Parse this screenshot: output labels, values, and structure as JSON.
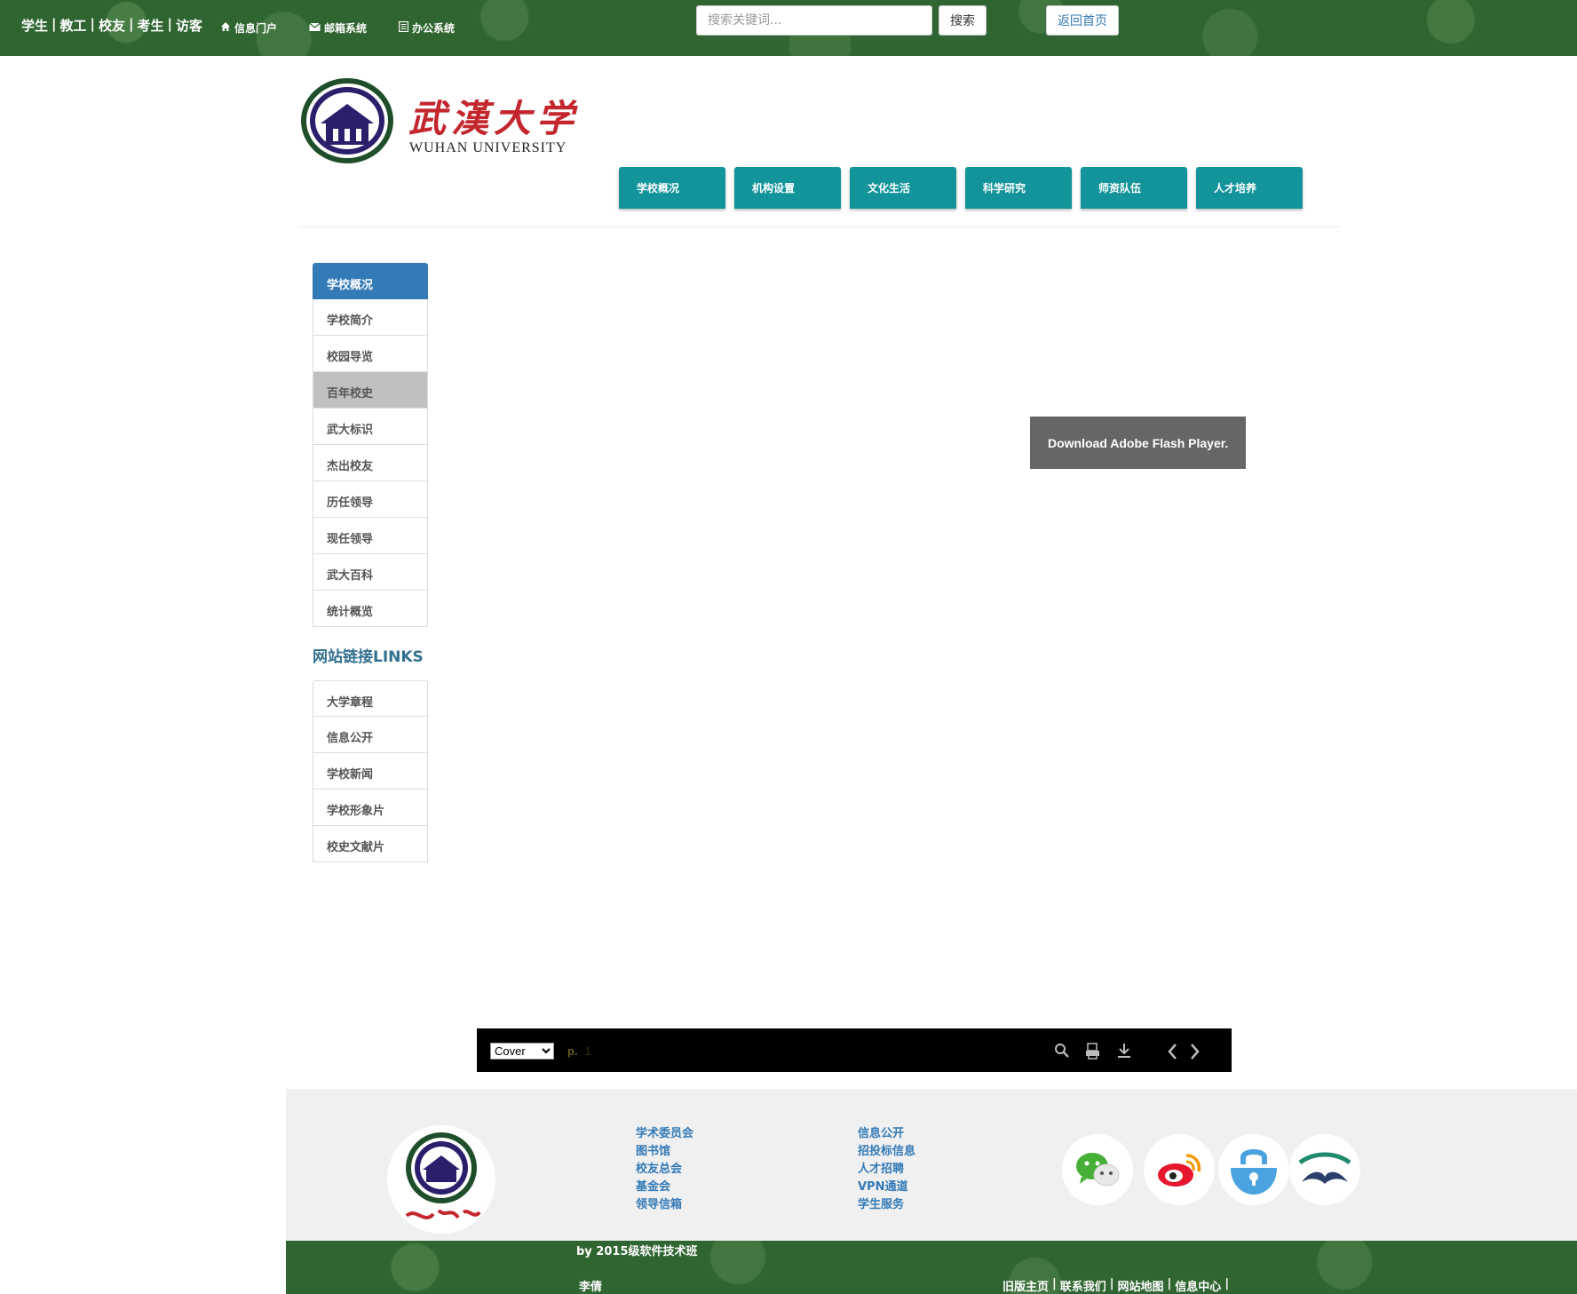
{
  "topbar": {
    "roles": [
      "学生",
      "教工",
      "校友",
      "考生",
      "访客"
    ],
    "separator": "|",
    "quick_links": [
      {
        "icon": "home-icon",
        "label": "信息门户"
      },
      {
        "icon": "mail-icon",
        "label": "邮箱系统"
      },
      {
        "icon": "document-icon",
        "label": "办公系统"
      }
    ],
    "search_placeholder": "搜索关键词...",
    "search_label": "搜索",
    "home_label": "返回首页"
  },
  "header": {
    "logo_cn": "武漢大学",
    "logo_en": "WUHAN UNIVERSITY",
    "nav": [
      "学校概况",
      "机构设置",
      "文化生活",
      "科学研究",
      "师资队伍",
      "人才培养"
    ]
  },
  "sidebar": {
    "title": "学校概况",
    "items": [
      "学校简介",
      "校园导览",
      "百年校史",
      "武大标识",
      "杰出校友",
      "历任领导",
      "现任领导",
      "武大百科",
      "统计概览"
    ],
    "active_index": 2,
    "links_title": "网站链接LINKS",
    "links": [
      "大学章程",
      "信息公开",
      "学校新闻",
      "学校形象片",
      "校史文献片"
    ]
  },
  "flash": {
    "label": "Download Adobe Flash Player."
  },
  "viewer": {
    "select_value": "Cover",
    "page_prefix": "p.",
    "page_number": "1",
    "icons": [
      "zoom-icon",
      "print-icon",
      "download-icon",
      "prev-page-icon",
      "next-page-icon"
    ]
  },
  "footer": {
    "col1": [
      "学术委员会",
      "图书馆",
      "校友总会",
      "基金会",
      "领导信箱"
    ],
    "col2": [
      "信息公开",
      "招投标信息",
      "人才招聘",
      "VPN通道",
      "学生服务"
    ],
    "social": [
      "wechat-icon",
      "weibo-icon",
      "lock-icon",
      "book-icon"
    ],
    "credit": "by 2015级软件技术班",
    "author": "李倩",
    "bottom_links": [
      "旧版主页",
      "联系我们",
      "网站地图",
      "信息中心"
    ],
    "colors": {
      "green": "#2f6530",
      "teal": "#12949a",
      "blue": "#337ab7"
    }
  }
}
